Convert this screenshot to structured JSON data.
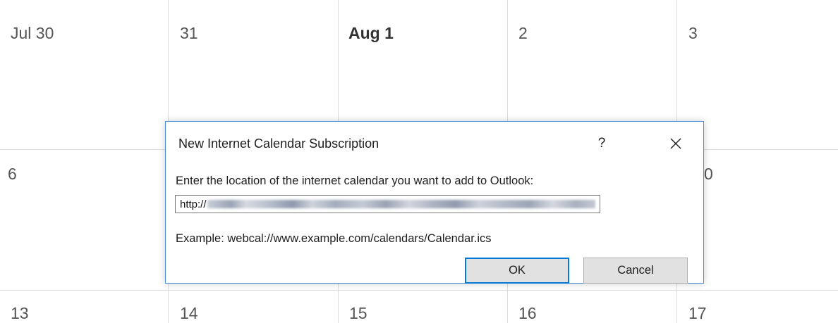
{
  "calendar": {
    "days": [
      "Jul 30",
      "31",
      "Aug 1",
      "2",
      "3",
      "6",
      "0",
      "13",
      "14",
      "15",
      "16",
      "17"
    ]
  },
  "dialog": {
    "title": "New Internet Calendar Subscription",
    "help_icon": "?",
    "prompt": "Enter the location of the internet calendar you want to add to Outlook:",
    "url_value": "http://",
    "example": "Example: webcal://www.example.com/calendars/Calendar.ics",
    "ok_label": "OK",
    "cancel_label": "Cancel"
  }
}
